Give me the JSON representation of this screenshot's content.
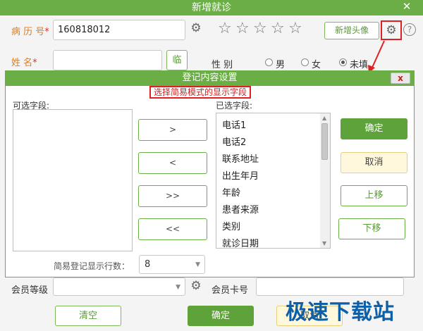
{
  "window": {
    "title": "新增就诊",
    "close": "✕"
  },
  "form": {
    "record_no_label": "病 历 号",
    "record_no_value": "160818012",
    "name_label": "姓    名",
    "temp_button": "临",
    "add_avatar_button": "新增头像",
    "gender_label": "性      别",
    "gender_options": [
      "男",
      "女",
      "未填"
    ],
    "member_level_label": "会员等级",
    "member_card_label": "会员卡号",
    "clear_button": "清空",
    "confirm_button": "确定",
    "cancel_button": "取消"
  },
  "dialog": {
    "title": "登记内容设置",
    "close": "x",
    "annotation": "选择简易模式的显示字段",
    "available_label": "可选字段:",
    "selected_label": "已选字段:",
    "selected_fields": [
      "电话1",
      "电话2",
      "联系地址",
      "出生年月",
      "年龄",
      "患者来源",
      "类别",
      "就诊日期"
    ],
    "move_buttons": [
      ">",
      "<",
      ">>",
      "<<"
    ],
    "rows_label": "简易登记显示行数：",
    "rows_value": "8",
    "confirm_button": "确定",
    "cancel_button": "取消",
    "move_up_button": "上移",
    "move_down_button": "下移"
  },
  "icons": {
    "star": "☆",
    "gear": "⚙",
    "help": "?"
  },
  "watermark": "极速下载站",
  "colors": {
    "accent": "#6aae45",
    "highlight": "#e02020",
    "label_orange": "#e07c1c"
  }
}
